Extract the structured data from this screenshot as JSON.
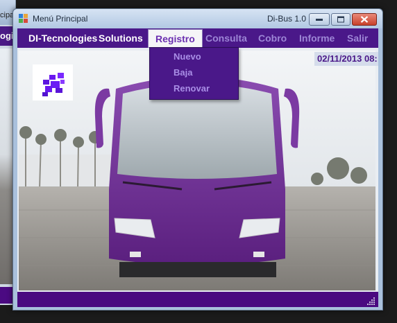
{
  "background_window": {
    "title_fragment": "cipa",
    "menu_fragment": "ogi"
  },
  "window": {
    "title": "Menú Principal",
    "app_label": "Di-Bus 1.0",
    "controls": {
      "minimize": "minimize-icon",
      "maximize": "maximize-icon",
      "close": "close-icon"
    }
  },
  "menubar": {
    "brand": "DI-Tecnologies",
    "items": [
      {
        "label": "Solutions"
      },
      {
        "label": "Registro",
        "state": "open"
      },
      {
        "label": "Consulta"
      },
      {
        "label": "Cobro"
      },
      {
        "label": "Informe"
      },
      {
        "label": "Salir"
      }
    ]
  },
  "dropdown": {
    "items": [
      {
        "label": "Nuevo"
      },
      {
        "label": "Baja"
      },
      {
        "label": "Renovar"
      }
    ]
  },
  "datetime": "02/11/2013 08:",
  "colors": {
    "menu_bg": "#4a1889",
    "status_bg": "#4a0a80",
    "bus_body": "#6a2a8e",
    "accent_text": "#a98ee6"
  }
}
